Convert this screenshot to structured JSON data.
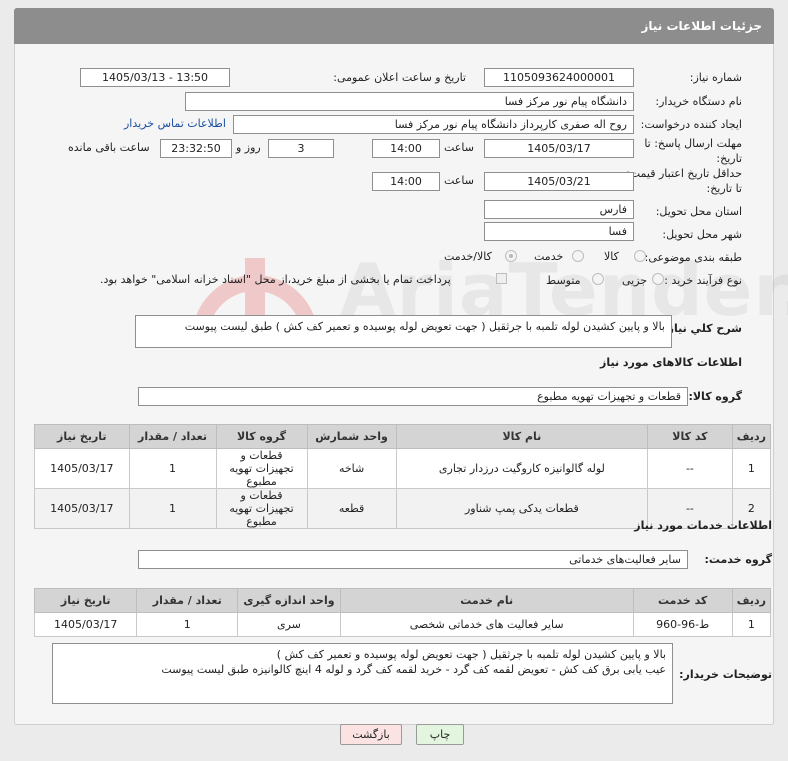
{
  "page_title": "جزئیات اطلاعات نیاز",
  "fields": {
    "need_number_label": "شماره نیاز:",
    "need_number": "1105093624000001",
    "announce_label": "تاریخ و ساعت اعلان عمومی:",
    "announce_value": "1405/03/13 - 13:50",
    "buyer_org_label": "نام دستگاه خریدار:",
    "buyer_org": "دانشگاه پیام نور مرکز فسا",
    "creator_label": "ایجاد کننده درخواست:",
    "creator": "روح اله  صفری کارپرداز دانشگاه پیام نور مرکز فسا",
    "contact_link": "اطلاعات تماس خریدار",
    "deadline_label_1": "مهلت ارسال پاسخ: تا",
    "deadline_label_2": "تاریخ:",
    "deadline_date": "1405/03/17",
    "time_label": "ساعت",
    "deadline_time": "14:00",
    "days_value": "3",
    "days_label": "روز و",
    "remaining_time": "23:32:50",
    "remaining_label": "ساعت باقی مانده",
    "validity_label_1": "حداقل تاریخ اعتبار قیمت:",
    "validity_label_2": "تا تاریخ:",
    "validity_date": "1405/03/21",
    "validity_time": "14:00",
    "province_label": "استان محل تحویل:",
    "province": "فارس",
    "city_label": "شهر محل تحویل:",
    "city": "فسا",
    "category_label": "طبقه بندی موضوعی:",
    "category_options": [
      "کالا",
      "خدمت",
      "کالا/خدمت"
    ],
    "process_label": "نوع فرآیند خرید :",
    "process_options": [
      "جزیی",
      "متوسط"
    ],
    "payment_note": "پرداخت تمام یا بخشی از مبلغ خرید،از محل \"اسناد خزانه اسلامی\" خواهد بود."
  },
  "summary": {
    "label": "شرح کلي نیاز:",
    "text": "بالا و پایین کشیدن لوله تلمبه با جرثقیل  ( جهت تعویض لوله پوسیده و تعمیر کف کش ) طبق لیست پیوست"
  },
  "goods": {
    "section_title": "اطلاعات کالاهای مورد نیاز",
    "group_label": "گروه کالا:",
    "group_value": "قطعات و تجهیزات تهویه مطبوع",
    "headers": [
      "ردیف",
      "کد کالا",
      "نام کالا",
      "واحد شمارش",
      "گروه کالا",
      "تعداد / مقدار",
      "تاریخ نیاز"
    ],
    "rows": [
      [
        "1",
        "--",
        "لوله گالوانیزه کاروگیت درزدار تجاری",
        "شاخه",
        "قطعات و تجهیزات تهویه مطبوع",
        "1",
        "1405/03/17"
      ],
      [
        "2",
        "--",
        "قطعات یدکی پمپ شناور",
        "قطعه",
        "قطعات و تجهیزات تهویه مطبوع",
        "1",
        "1405/03/17"
      ]
    ]
  },
  "services": {
    "section_title": "اطلاعات خدمات مورد نیاز",
    "group_label": "گروه خدمت:",
    "group_value": "سایر فعالیت‌های خدماتی",
    "headers": [
      "ردیف",
      "کد خدمت",
      "نام خدمت",
      "واحد اندازه گیری",
      "تعداد / مقدار",
      "تاریخ نیاز"
    ],
    "rows": [
      [
        "1",
        "ط-96-960",
        "سایر فعالیت های خدماتی شخصی",
        "سری",
        "1",
        "1405/03/17"
      ]
    ]
  },
  "buyer_notes": {
    "label": "توضیحات خریدار:",
    "text": "بالا و پایین کشیدن لوله تلمبه با جرثقیل  ( جهت تعویض لوله پوسیده و تعمیر کف کش )\nعیب یابی برق کف کش - تعویض لقمه کف گرد - خرید لقمه کف گرد و لوله 4 اینچ کالوانیزه طبق لیست پیوست"
  },
  "buttons": {
    "print": "چاپ",
    "back": "بازگشت"
  },
  "watermark_text": "AriaTender.neT",
  "colors": {
    "title_bar": "#8d8d8d",
    "link": "#1a4fa3",
    "back_button": "#fbe3e3",
    "print_button": "#e4f5df"
  }
}
